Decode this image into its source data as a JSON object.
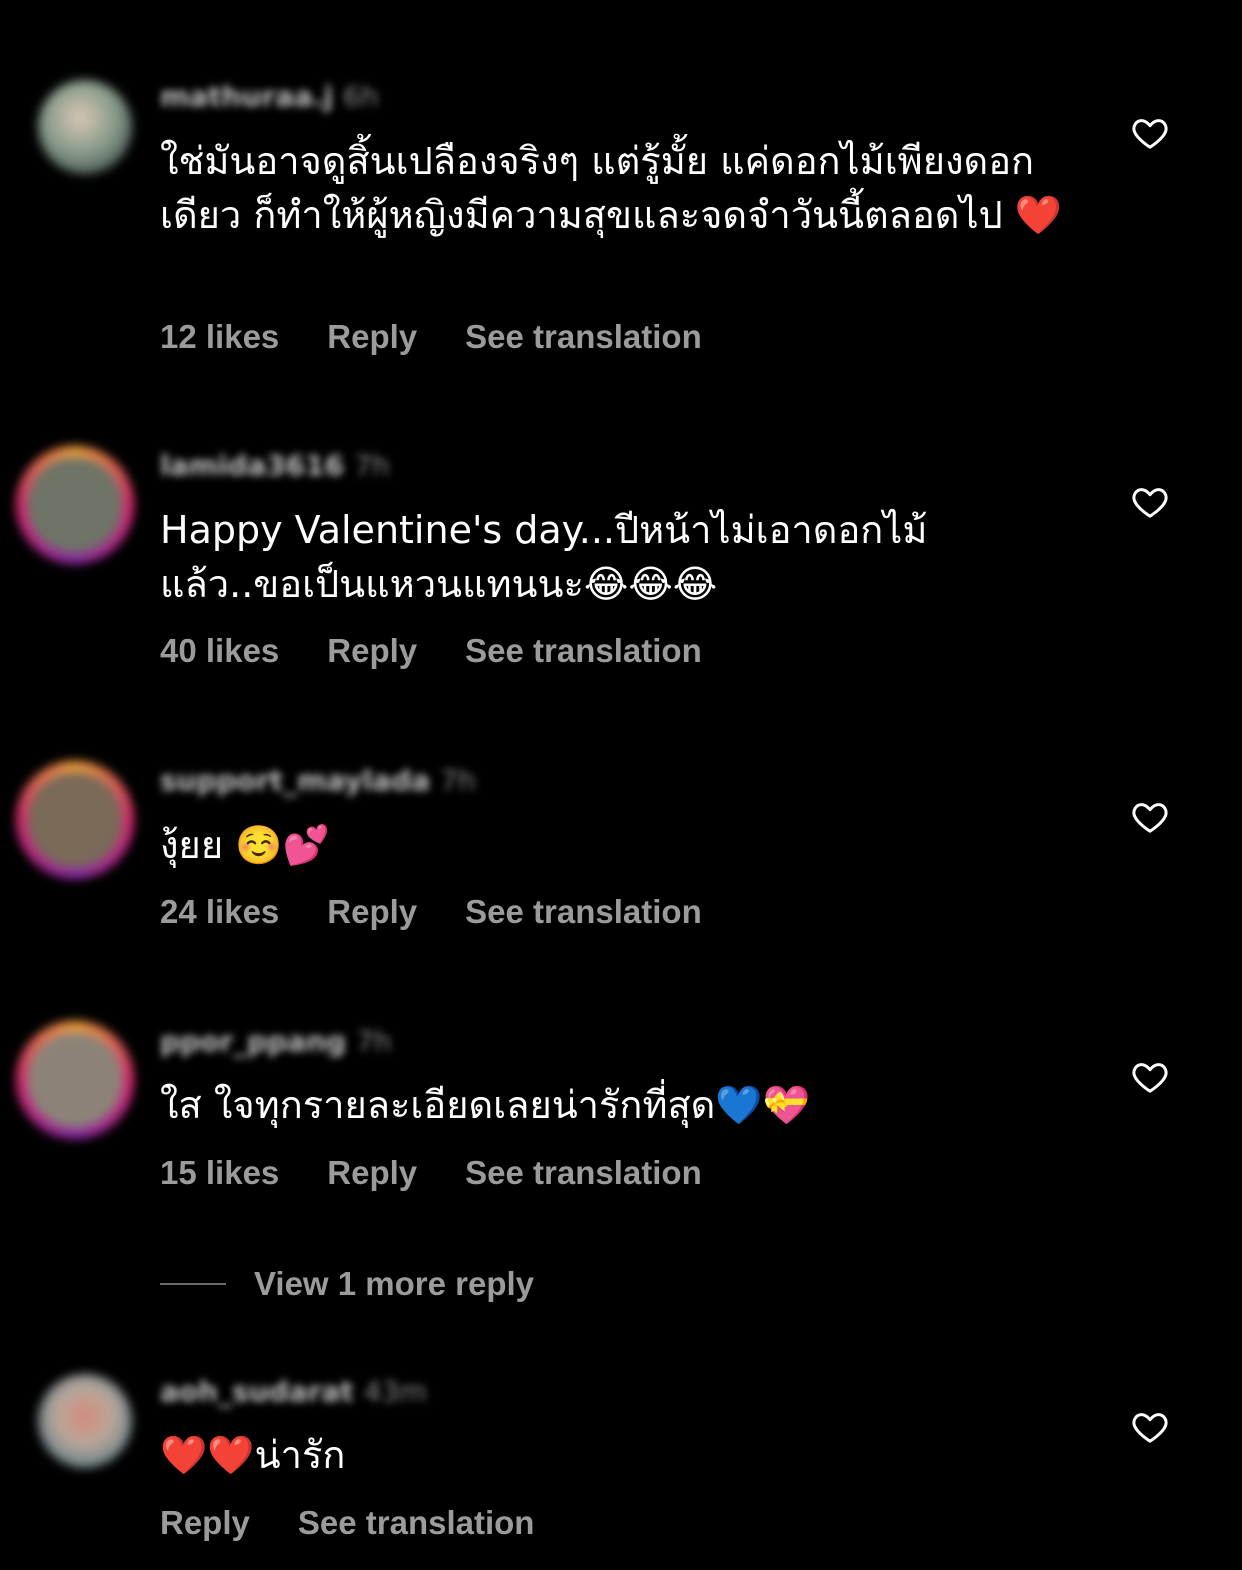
{
  "comments": [
    {
      "username": "mathuraa.j",
      "time": "6h",
      "text": "ใช่มันอาจดูสิ้นเปลืองจริงๆ แต่รู้มั้ย แค่ดอกไม้เพียงดอกเดียว ก็ทำให้ผู้หญิงมีความสุขและจดจำวันนี้ตลอดไป ❤️",
      "likes": "12 likes",
      "reply": "Reply",
      "translate": "See translation"
    },
    {
      "username": "lamida3616",
      "time": "7h",
      "text": "Happy Valentine's day...ปีหน้าไม่เอาดอกไม้แล้ว..ขอเป็นแหวนแทนนะ😂😂😂",
      "likes": "40 likes",
      "reply": "Reply",
      "translate": "See translation"
    },
    {
      "username": "support_maylada",
      "time": "7h",
      "text": "งุ้ยย ☺️💕",
      "likes": "24 likes",
      "reply": "Reply",
      "translate": "See translation"
    },
    {
      "username": "ppor_ppang",
      "time": "7h",
      "text": "ใส ใจทุกรายละเอียดเลยน่ารักที่สุด💙💝",
      "likes": "15 likes",
      "reply": "Reply",
      "translate": "See translation"
    },
    {
      "username": "aoh_sudarat",
      "time": "43m",
      "text": "❤️❤️น่ารัก",
      "reply": "Reply",
      "translate": "See translation"
    }
  ],
  "view_more_replies": "View 1 more reply",
  "icons": {
    "like": "heart-outline-icon"
  },
  "colors": {
    "background": "#000000",
    "text": "#ffffff",
    "secondary_text": "#9b9b9b",
    "story_ring": [
      "#f3a33b",
      "#d6296f",
      "#8a2aa3"
    ]
  }
}
